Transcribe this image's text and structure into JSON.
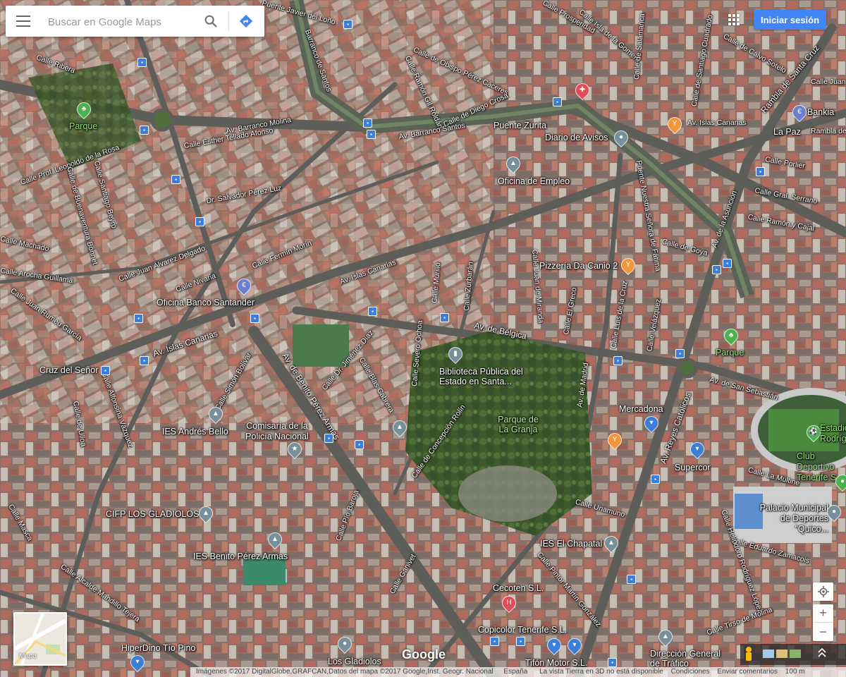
{
  "search": {
    "placeholder": "Buscar en Google Maps"
  },
  "header": {
    "signin_label": "Iniciar sesión"
  },
  "minimap": {
    "label": "Mapa"
  },
  "brand": {
    "logo": "Google"
  },
  "footer": {
    "attribution": "Imágenes ©2017 DigitalGlobe,GRAFCAN,Datos del mapa ©2017 Google,Inst. Geogr. Nacional",
    "country": "España",
    "notice": "La vista Tierra en 3D no está disponible",
    "terms": "Condiciones",
    "feedback": "Enviar comentarios",
    "scale": "100 m"
  },
  "controls": {
    "zoom_in": "+",
    "zoom_out": "−"
  },
  "colors": {
    "accent": "#4285f4",
    "pin_gray": "#78909c",
    "pin_orange": "#f2963c",
    "pin_green": "#4caf50",
    "pin_blue": "#3d7fd6",
    "pin_red": "#e04c5a"
  },
  "places": [
    {
      "name": "Parque",
      "icon": "tree-icon"
    },
    {
      "name": "Puente Zurita",
      "icon": ""
    },
    {
      "name": "Diario de Avisos",
      "icon": "pin-icon"
    },
    {
      "name": "Bankia",
      "icon": "bank-icon"
    },
    {
      "name": "La Paz",
      "icon": "bus-icon"
    },
    {
      "name": "Oficina de Empleo",
      "icon": "government-icon"
    },
    {
      "name": "Pizzería Da Canio 2",
      "icon": "restaurant-icon"
    },
    {
      "name": "Oficina Banco Santander",
      "icon": "bank-icon"
    },
    {
      "name": "Parque",
      "icon": "tree-icon"
    },
    {
      "name": "Cruz del Señor",
      "icon": "bus-icon"
    },
    {
      "name": "Biblioteca Pública del Estado en Santa...",
      "icon": "library-icon"
    },
    {
      "name": "Parque de La Granja",
      "icon": ""
    },
    {
      "name": "Mercadona",
      "icon": "shopping-icon"
    },
    {
      "name": "IES Andrés Bello",
      "icon": "school-icon"
    },
    {
      "name": "Comisaría de la Policía Nacional",
      "icon": "police-icon"
    },
    {
      "name": "Supercor",
      "icon": "shopping-icon"
    },
    {
      "name": "Estadio Rodríguez",
      "icon": "stadium-icon"
    },
    {
      "name": "Club Deportivo Tenerife S",
      "icon": ""
    },
    {
      "name": "CIFP LOS GLADIOLOS",
      "icon": "school-icon"
    },
    {
      "name": "Palacio Municipal de Deportes \"Quico...",
      "icon": "sports-icon"
    },
    {
      "name": "IES Benito Pérez Armas",
      "icon": "school-icon"
    },
    {
      "name": "IES El Chapatal",
      "icon": "school-icon"
    },
    {
      "name": "Cecoten S.L.",
      "icon": "hospital-icon"
    },
    {
      "name": "Copicolor Tenerife S.L.",
      "icon": ""
    },
    {
      "name": "HiperDino Tío Pino",
      "icon": "shopping-icon"
    },
    {
      "name": "Los Gladiolos",
      "icon": "pin-icon"
    },
    {
      "name": "Tifón Motor S.L.",
      "icon": ""
    },
    {
      "name": "Dirección General de Tráfico",
      "icon": "government-icon"
    }
  ],
  "streets": [
    "Puente Javier del Loño",
    "Calle Prosperidad",
    "Calle Isla de la Gomera",
    "Calle de Salamanca",
    "Calle de Santiago Cuadrado",
    "Calle de Calvo Sotelo",
    "Rambla de Santa Cruz",
    "Calle Juan",
    "Calle Ribera",
    "Barranco de Santos",
    "Calle de Obispo Pérez Cáceres",
    "Calle Ramón Gil Roldán",
    "Calle de Diego Crosa",
    "Av. Barranco Molina",
    "Calle Esther Tellado Afonso",
    "Av. Barranco Santos",
    "Av. Islas Canarias",
    "Rambla de",
    "Calle Prof. Leopoldo de la Rosa",
    "Calle Porlier",
    "Dr. Salvador Pérez Luz",
    "Calle Gral. Serrano",
    "Calle Ramón y Cajal",
    "Calle de Goya",
    "Av. de la Asunción",
    "Puente Nuestra Señora de Fátima",
    "Calle Fermín Morín",
    "Calle Juan Álvarez Delgado",
    "Calle Nivaria",
    "Av. Islas Canarias",
    "Calle Murillo",
    "Calle Zurbarán",
    "Calle Juan de Miranda",
    "Calle El Greco",
    "Calle Luis de la Cruz",
    "Calle Velázquez",
    "Av. de Bélgica",
    "Calle Severo Ochoa",
    "Calle Dr. Jiménez Díaz",
    "Calle Blas Cabrera",
    "Av. Islas Canarias",
    "Calle Simón Bolívar",
    "Av. de Benito Pérez Armas",
    "Calle de Concepción Rolín",
    "Av. de Madrid",
    "Av. Reyes Católicos",
    "Av. de San Sebastián",
    "Calle La Multine",
    "Calle Unamuno",
    "Calle Eduardo Zamacois",
    "Calle Heliodoro Rodríguez López",
    "Calle Pío Baroja",
    "Calle Ganivet",
    "Calle Pintor Martín González",
    "Calle Tirso de Molina",
    "Calle Alcalde Mandillo Tejera",
    "Calle Alfonsina Vázquez",
    "Calle de Ulloa",
    "Calle Juan Rumeu García",
    "Calle Arocha Guillama",
    "Calle Machado",
    "Calle Santiago Beyro",
    "Calle de Buenaventura Bonnet",
    "Calle Masca"
  ]
}
